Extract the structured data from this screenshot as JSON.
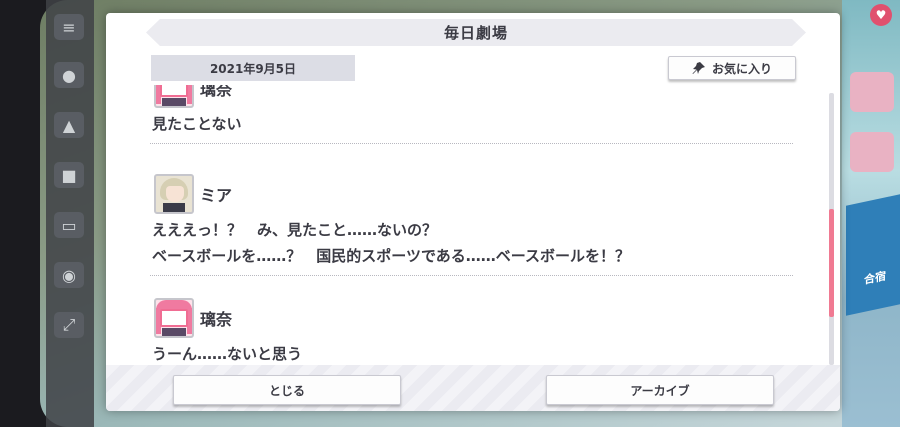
{
  "dialog": {
    "title": "毎日劇場",
    "date": "2021年9月5日",
    "favorite_label": "お気に入り",
    "close_label": "とじる",
    "archive_label": "アーカイブ"
  },
  "log": [
    {
      "speaker": "璃奈",
      "avatar": "rina-avatar",
      "lines": [
        "見たことない"
      ]
    },
    {
      "speaker": "ミア",
      "avatar": "mia-avatar",
      "lines": [
        "えええっ！？　み、見たこと……ないの？",
        "ベースボールを……？　国民的スポーツである……ベースボールを！？"
      ]
    },
    {
      "speaker": "璃奈",
      "avatar": "rina-avatar",
      "lines": [
        "うーん……ないと思う"
      ]
    }
  ],
  "background": {
    "right_tile_label": "合宿"
  },
  "colors": {
    "accent_pink": "#f07a92",
    "text": "#3b3b44",
    "panel": "#ffffff"
  }
}
